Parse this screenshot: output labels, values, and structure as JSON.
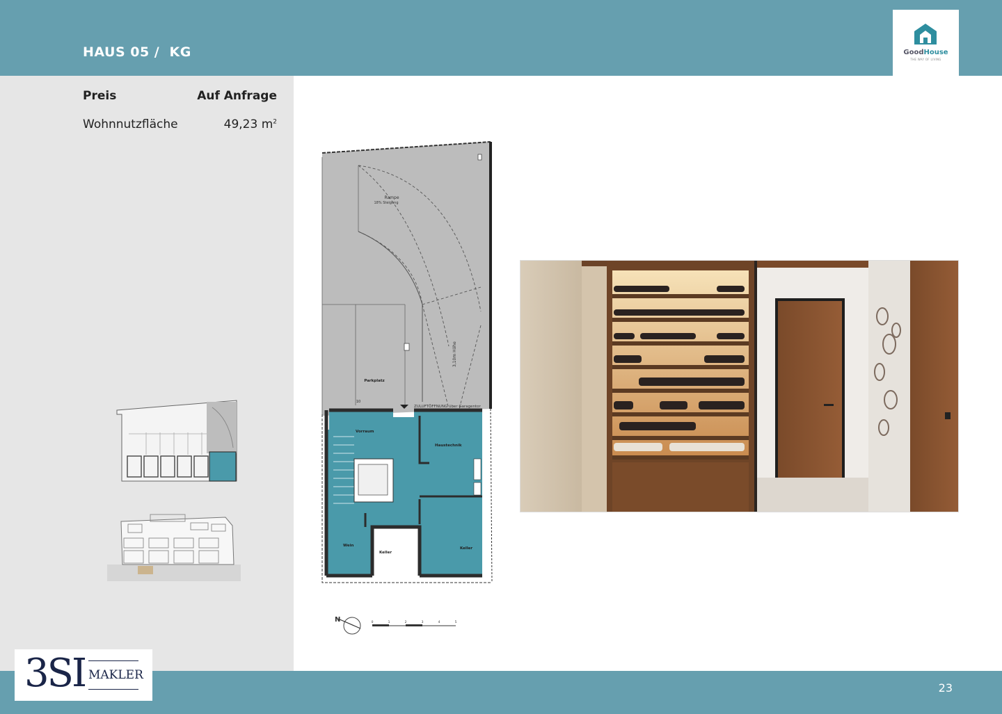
{
  "header": {
    "title": "HAUS 05 /  KG",
    "logo_name_part1": "Good",
    "logo_name_part2": "House",
    "logo_tagline": "THE WAY OF LIVING",
    "bar_color": "#669faf"
  },
  "info": {
    "price_label": "Preis",
    "price_value": "Auf Anfrage",
    "area_label": "Wohnnutzfläche",
    "area_value": "49,23 m",
    "area_unit_sup": "2"
  },
  "floorplan": {
    "ramp_label": "Rampe",
    "ramp_sub": "18% Steigung",
    "parking_label": "Parkplatz",
    "opening_label": "ZULUFTÖFFNUNG über Garagentor",
    "vorraum_label": "Vorraum",
    "haustechnik_label": "Haustechnik",
    "wein_label": "Wein",
    "keller1_label": "Keller",
    "keller2_label": "Keller",
    "height_note": "3,10m Höhe",
    "parking_number": "10",
    "scale_labels": [
      "0",
      "1",
      "2",
      "3",
      "4",
      "5"
    ],
    "north_label": "N",
    "accent_color": "#4a9aaa"
  },
  "footer": {
    "page_number": "23",
    "brand_main": "3SI",
    "brand_sub": "MAKLER"
  }
}
